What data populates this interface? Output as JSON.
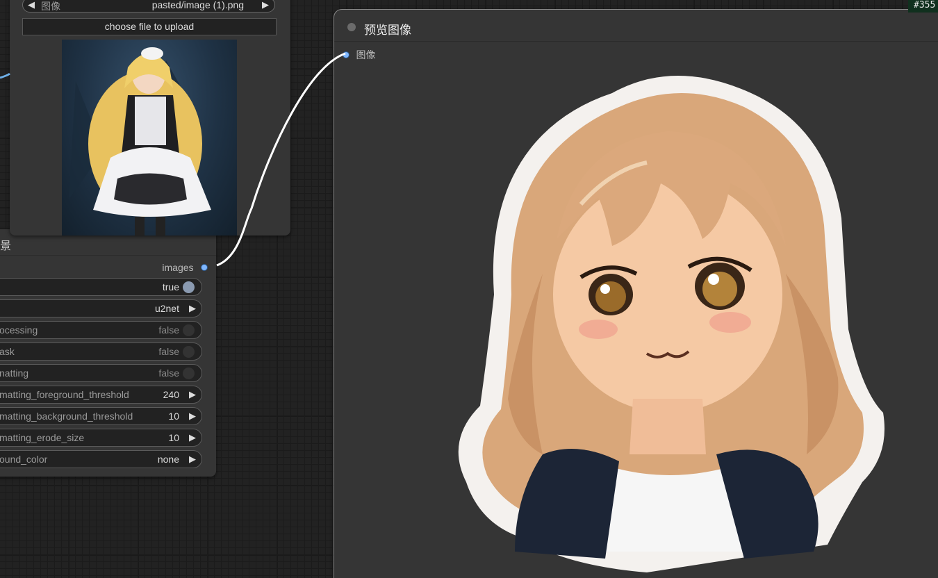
{
  "load_node": {
    "image_combo": {
      "label": "图像",
      "value": "pasted/image (1).png"
    },
    "upload_button": "choose file to upload"
  },
  "rembg_node": {
    "title_fragment": "景",
    "output_label": "images",
    "widgets": [
      {
        "name": "",
        "value": "true",
        "kind": "toggle",
        "on": true
      },
      {
        "name": "",
        "value": "u2net",
        "kind": "combo"
      },
      {
        "name": "ocessing",
        "value": "false",
        "kind": "toggle",
        "on": false
      },
      {
        "name": "ask",
        "value": "false",
        "kind": "toggle",
        "on": false
      },
      {
        "name": "natting",
        "value": "false",
        "kind": "toggle",
        "on": false
      },
      {
        "name": "matting_foreground_threshold",
        "value": "240",
        "kind": "number"
      },
      {
        "name": "matting_background_threshold",
        "value": "10",
        "kind": "number"
      },
      {
        "name": "matting_erode_size",
        "value": "10",
        "kind": "number"
      },
      {
        "name": "ound_color",
        "value": "none",
        "kind": "combo"
      }
    ]
  },
  "preview_node": {
    "title": "预览图像",
    "input_label": "图像"
  },
  "corner_badge": "#355",
  "colors": {
    "canvas": "#222222",
    "node_bg": "#353535",
    "link": "#ffffff",
    "slot": "#7fb7ff",
    "badge_bg": "#10301e"
  }
}
